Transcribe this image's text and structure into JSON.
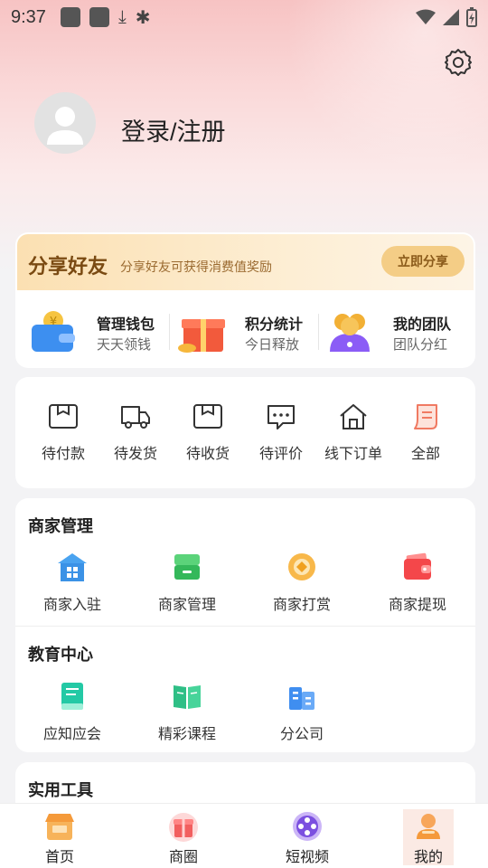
{
  "status_bar": {
    "time": "9:37"
  },
  "profile": {
    "login_label": "登录/注册"
  },
  "share": {
    "title": "分享好友",
    "subtitle": "分享好友可获得消费值奖励",
    "button": "立即分享"
  },
  "features": [
    {
      "title": "管理钱包",
      "subtitle": "天天领钱",
      "icon": "wallet-icon"
    },
    {
      "title": "积分统计",
      "subtitle": "今日释放",
      "icon": "gift-icon"
    },
    {
      "title": "我的团队",
      "subtitle": "团队分红",
      "icon": "team-icon"
    }
  ],
  "orders": [
    {
      "label": "待付款",
      "icon": "pending-payment-icon"
    },
    {
      "label": "待发货",
      "icon": "truck-icon"
    },
    {
      "label": "待收货",
      "icon": "box-icon"
    },
    {
      "label": "待评价",
      "icon": "comment-icon"
    },
    {
      "label": "线下订单",
      "icon": "store-icon"
    },
    {
      "label": "全部",
      "icon": "document-icon"
    }
  ],
  "merchant": {
    "title": "商家管理",
    "items": [
      {
        "label": "商家入驻",
        "icon": "shop-icon"
      },
      {
        "label": "商家管理",
        "icon": "store-manage-icon"
      },
      {
        "label": "商家打赏",
        "icon": "coin-icon"
      },
      {
        "label": "商家提现",
        "icon": "wallet-red-icon"
      }
    ]
  },
  "education": {
    "title": "教育中心",
    "items": [
      {
        "label": "应知应会",
        "icon": "book-icon"
      },
      {
        "label": "精彩课程",
        "icon": "open-book-icon"
      },
      {
        "label": "分公司",
        "icon": "building-icon"
      }
    ]
  },
  "tools": {
    "title": "实用工具"
  },
  "tabs": [
    {
      "label": "首页",
      "icon": "home-shop-icon"
    },
    {
      "label": "商圈",
      "icon": "gift-box-icon"
    },
    {
      "label": "短视频",
      "icon": "film-reel-icon"
    },
    {
      "label": "我的",
      "icon": "profile-icon",
      "active": true
    }
  ],
  "colors": {
    "accent_gold": "#f4cd86",
    "share_text": "#7a4a12",
    "hero_pink": "#f7c3c3"
  }
}
